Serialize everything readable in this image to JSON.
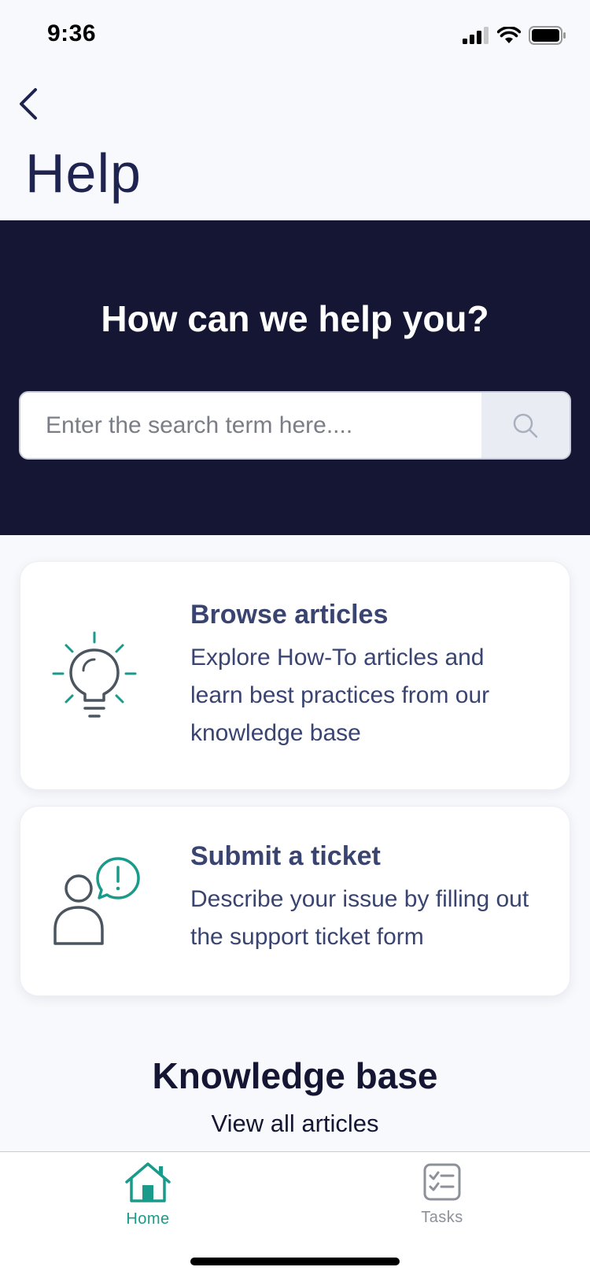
{
  "status_bar": {
    "time": "9:36"
  },
  "header": {
    "title": "Help"
  },
  "hero": {
    "title": "How can we help you?",
    "search_placeholder": "Enter the search term here...."
  },
  "cards": [
    {
      "title": "Browse articles",
      "description": "Explore How-To articles and learn best practices from our knowledge base",
      "icon": "lightbulb-icon"
    },
    {
      "title": "Submit a ticket",
      "description": "Describe your issue by filling out the support ticket form",
      "icon": "user-alert-icon"
    }
  ],
  "knowledge_base": {
    "title": "Knowledge base",
    "link": "View all articles"
  },
  "tab_bar": {
    "tabs": [
      {
        "label": "Home",
        "icon": "home-icon",
        "active": true
      },
      {
        "label": "Tasks",
        "icon": "tasks-icon",
        "active": false
      }
    ]
  },
  "colors": {
    "hero_bg": "#151633",
    "accent": "#1a9a8a",
    "card_text": "#3a4470",
    "inactive_tab": "#8d9099"
  }
}
